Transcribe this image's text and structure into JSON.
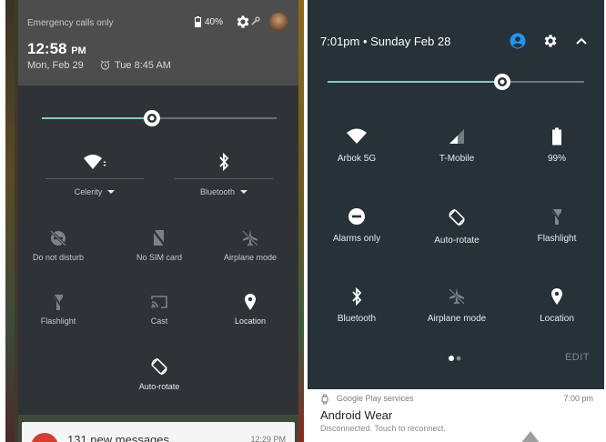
{
  "colors": {
    "left_bg": "#2f3336",
    "left_header": "#4d4d4d",
    "right_bg": "#263238",
    "accent_teal": "#80cbc4",
    "account_blue": "#2196f3",
    "icon_white": "#ffffff",
    "icon_dim": "#7b8185"
  },
  "left": {
    "status_text": "Emergency calls only",
    "battery_text": "40%",
    "time": "12:58",
    "time_ampm": "PM",
    "date": "Mon, Feb 29",
    "alarm": "Tue 8:45 AM",
    "brightness_level": 0.51,
    "icons": {
      "battery": "battery-icon",
      "settings": "gear-icon",
      "wrench": "wrench-icon",
      "avatar": "avatar",
      "alarm": "alarm-clock-icon"
    },
    "tiles": [
      {
        "id": "wifi",
        "label": "Celerity",
        "icon": "wifi-icon",
        "dropdown": true
      },
      {
        "id": "bluetooth",
        "label": "Bluetooth",
        "icon": "bluetooth-icon",
        "dropdown": true
      },
      {
        "id": "dnd",
        "label": "Do not disturb",
        "icon": "do-not-disturb-icon"
      },
      {
        "id": "sim",
        "label": "No SIM card",
        "icon": "no-sim-icon"
      },
      {
        "id": "airplane",
        "label": "Airplane mode",
        "icon": "airplane-icon"
      },
      {
        "id": "flashlight",
        "label": "Flashlight",
        "icon": "flashlight-icon"
      },
      {
        "id": "cast",
        "label": "Cast",
        "icon": "cast-icon"
      },
      {
        "id": "location",
        "label": "Location",
        "icon": "location-icon"
      },
      {
        "id": "autorotate",
        "label": "Auto-rotate",
        "icon": "auto-rotate-icon"
      }
    ],
    "notification": {
      "title": "131 new messages",
      "time": "12:29 PM"
    }
  },
  "right": {
    "header_time": "7:01pm • Sunday Feb 28",
    "brightness_level": 0.68,
    "icons": {
      "account": "account-circle-icon",
      "settings": "gear-icon",
      "collapse": "chevron-up-icon"
    },
    "tiles": [
      {
        "id": "wifi",
        "label": "Arbok 5G",
        "icon": "wifi-icon"
      },
      {
        "id": "cell",
        "label": "T-Mobile",
        "icon": "cell-signal-icon"
      },
      {
        "id": "battery",
        "label": "99%",
        "icon": "battery-icon"
      },
      {
        "id": "alarms",
        "label": "Alarms only",
        "icon": "alarms-only-icon"
      },
      {
        "id": "autorotate",
        "label": "Auto-rotate",
        "icon": "auto-rotate-icon"
      },
      {
        "id": "flashlight",
        "label": "Flashlight",
        "icon": "flashlight-icon"
      },
      {
        "id": "bluetooth",
        "label": "Bluetooth",
        "icon": "bluetooth-icon"
      },
      {
        "id": "airplane",
        "label": "Airplane mode",
        "icon": "airplane-icon"
      },
      {
        "id": "location",
        "label": "Location",
        "icon": "location-icon"
      }
    ],
    "page_indicator": {
      "pages": 2,
      "current": 1
    },
    "edit_label": "EDIT",
    "notification": {
      "app": "Google Play services",
      "time": "7:00 pm",
      "title": "Android Wear",
      "text": "Disconnected. Touch to reconnect."
    }
  }
}
